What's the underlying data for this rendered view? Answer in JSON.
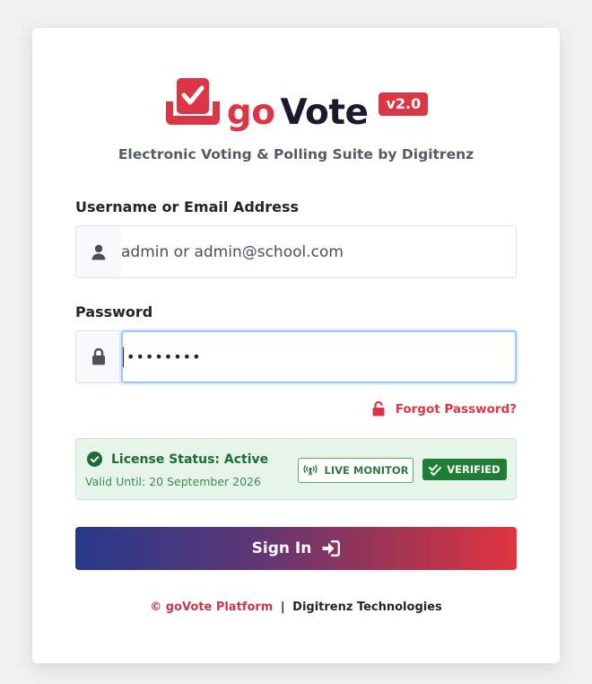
{
  "brand": {
    "go": "go",
    "vote": "Vote",
    "version": "v2.0",
    "tagline": "Electronic Voting & Polling Suite by Digitrenz"
  },
  "form": {
    "username_label": "Username or Email Address",
    "username_placeholder": "admin or admin@school.com",
    "password_label": "Password",
    "password_masked": "••••••••",
    "forgot_label": "Forgot Password?",
    "signin_label": "Sign In"
  },
  "license": {
    "status": "License Status: Active",
    "valid_until": "Valid Until: 20 September 2026",
    "live_monitor_label": "LIVE MONITOR",
    "verified_label": "VERIFIED"
  },
  "footer": {
    "platform": "© goVote Platform",
    "separator": "|",
    "company": "Digitrenz Technologies"
  },
  "icons": {
    "logo": "ballot-box-check-icon",
    "user": "user-icon",
    "lock": "lock-icon",
    "unlock": "unlock-icon",
    "check": "check-circle-icon",
    "broadcast": "broadcast-tower-icon",
    "double_check": "double-check-icon",
    "sign_in": "sign-in-icon"
  },
  "colors": {
    "brand_red": "#dc3545",
    "brand_dark": "#1a1a2e",
    "success_green": "#1e7e34",
    "gradient_start": "#253a8a",
    "gradient_end": "#e0343f"
  }
}
